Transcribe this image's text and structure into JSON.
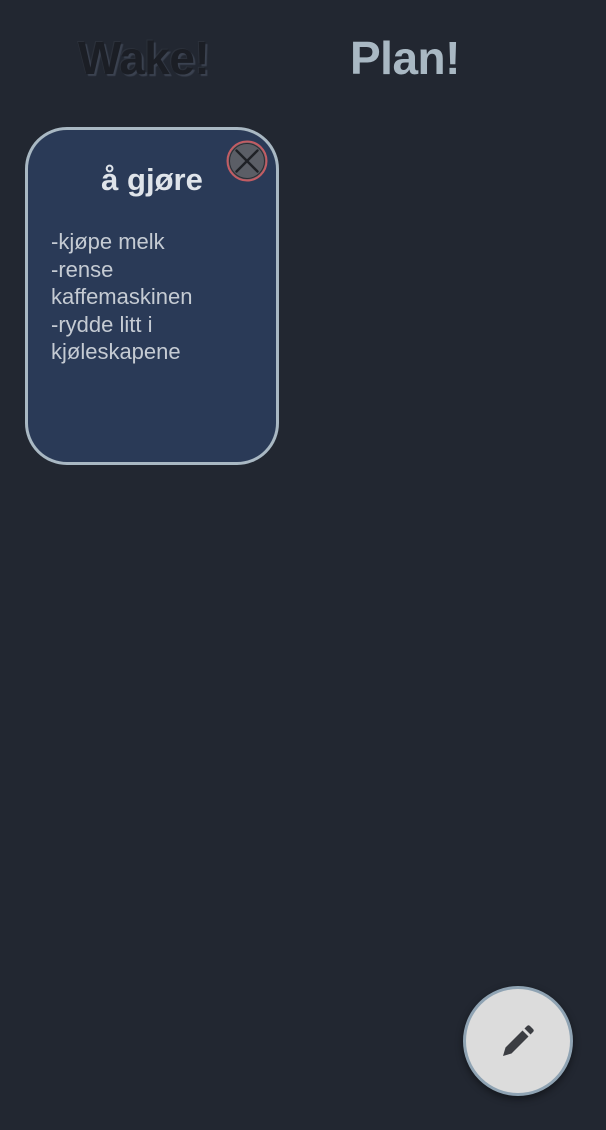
{
  "tabs": {
    "wake_label": "Wake!",
    "plan_label": "Plan!"
  },
  "note": {
    "title": "å gjøre",
    "body": "-kjøpe melk\n-rense\nkaffemaskinen\n-rydde litt i\nkjøleskapene"
  },
  "icons": {
    "close": "close-icon",
    "edit": "pencil-icon"
  },
  "colors": {
    "background": "#222731",
    "card": "#2a3a57",
    "card_border": "#a9b8c3",
    "active_tab": "#a9b8c3",
    "close_ring": "#c25c63",
    "fab": "#dcdcdc"
  }
}
